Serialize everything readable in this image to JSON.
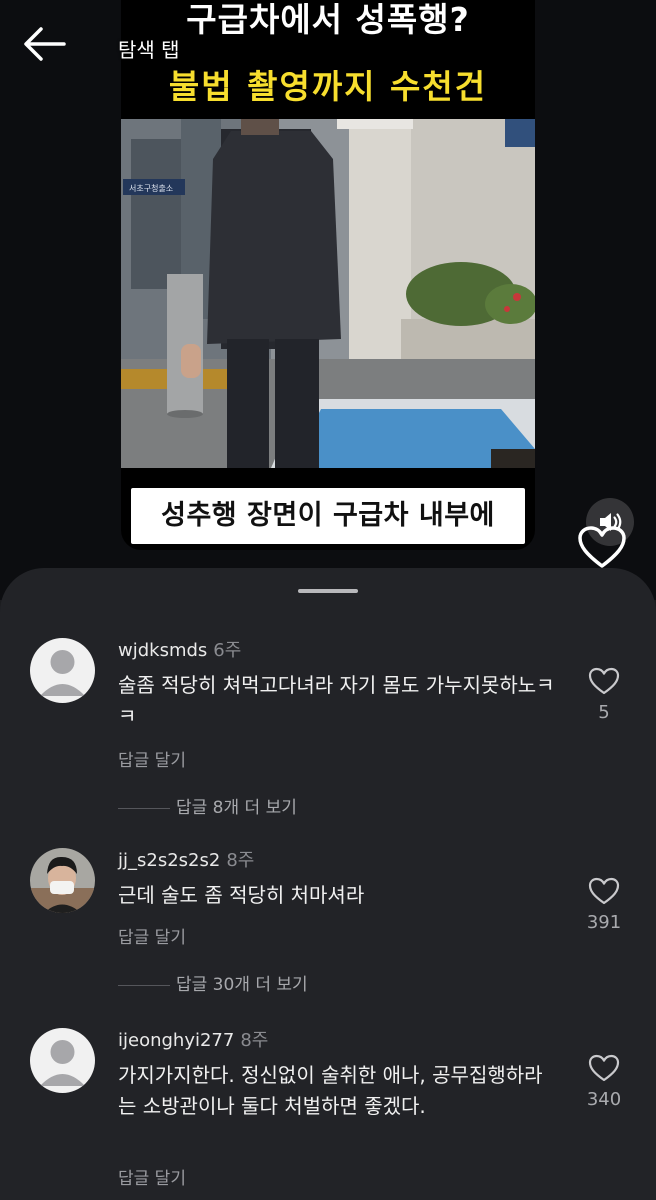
{
  "header": {
    "tab_label": "탐색 탭"
  },
  "video": {
    "headline_line1": "구급차에서 성폭행?",
    "headline_line2": "불법 촬영까지 수천건",
    "caption": "성추행 장면이 구급차 내부에",
    "sign_text": "서초구청출소"
  },
  "comments": [
    {
      "username": "wjdksmds",
      "age": "6주",
      "text": "술좀 적당히 쳐먹고다녀라 자기 몸도 가누지못하노ㅋㅋ",
      "reply_label": "답글 달기",
      "likes": "5",
      "more_replies": "답글 8개 더 보기"
    },
    {
      "username": "jj_s2s2s2s2",
      "age": "8주",
      "text": "근데 술도 좀 적당히 처마셔라",
      "reply_label": "답글 달기",
      "likes": "391",
      "more_replies": "답글 30개 더 보기"
    },
    {
      "username": "ijeonghyi277",
      "age": "8주",
      "text": "가지가지한다. 정신없이 술취한 애나, 공무집행하라는 소방관이나 둘다 처벌하면 좋겠다.",
      "reply_label": "답글 달기",
      "likes": "340"
    }
  ],
  "icons": {
    "back": "arrow-left-icon",
    "sound": "speaker-icon",
    "like": "heart-icon",
    "avatar_default": "default-avatar-icon"
  },
  "colors": {
    "headline_yellow": "#f7de2e",
    "sheet_bg": "#222327",
    "top_bg": "#0c0d10"
  }
}
